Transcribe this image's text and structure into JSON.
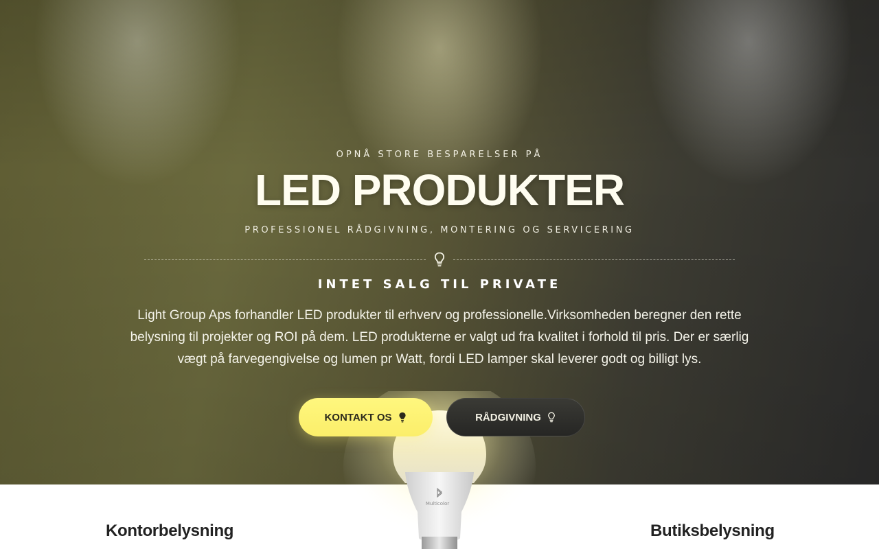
{
  "hero": {
    "eyebrow": "OPNÅ STORE BESPARELSER PÅ",
    "title": "LED PRODUKTER",
    "subtitle": "PROFESSIONEL RÅDGIVNING, MONTERING OG SERVICERING",
    "divider_icon": "lightbulb-outline-icon",
    "tagline": "INTET SALG TIL PRIVATE",
    "description": "Light Group Aps forhandler LED produkter til erhverv og professionelle.Virksomheden beregner den rette belysning til projekter og ROI på dem. LED produkterne er valgt ud fra kvalitet i forhold til pris. Der er særlig vægt på farvegengivelse og lumen pr Watt, fordi LED lamper skal leverer godt og billigt lys.",
    "primary_button": {
      "label": "KONTAKT OS",
      "icon": "lightbulb-filled-icon"
    },
    "secondary_button": {
      "label": "RÅDGIVNING",
      "icon": "lightbulb-outline-icon"
    }
  },
  "lamp": {
    "brand_text": "Multicolor",
    "icon": "bluetooth-icon"
  },
  "sections": {
    "left_heading": "Kontorbelysning",
    "right_heading": "Butiksbelysning"
  },
  "colors": {
    "primary_button": "#fbee6a",
    "secondary_button": "#2a2a28",
    "hero_text": "#fffdf0",
    "heading_text": "#222222"
  }
}
